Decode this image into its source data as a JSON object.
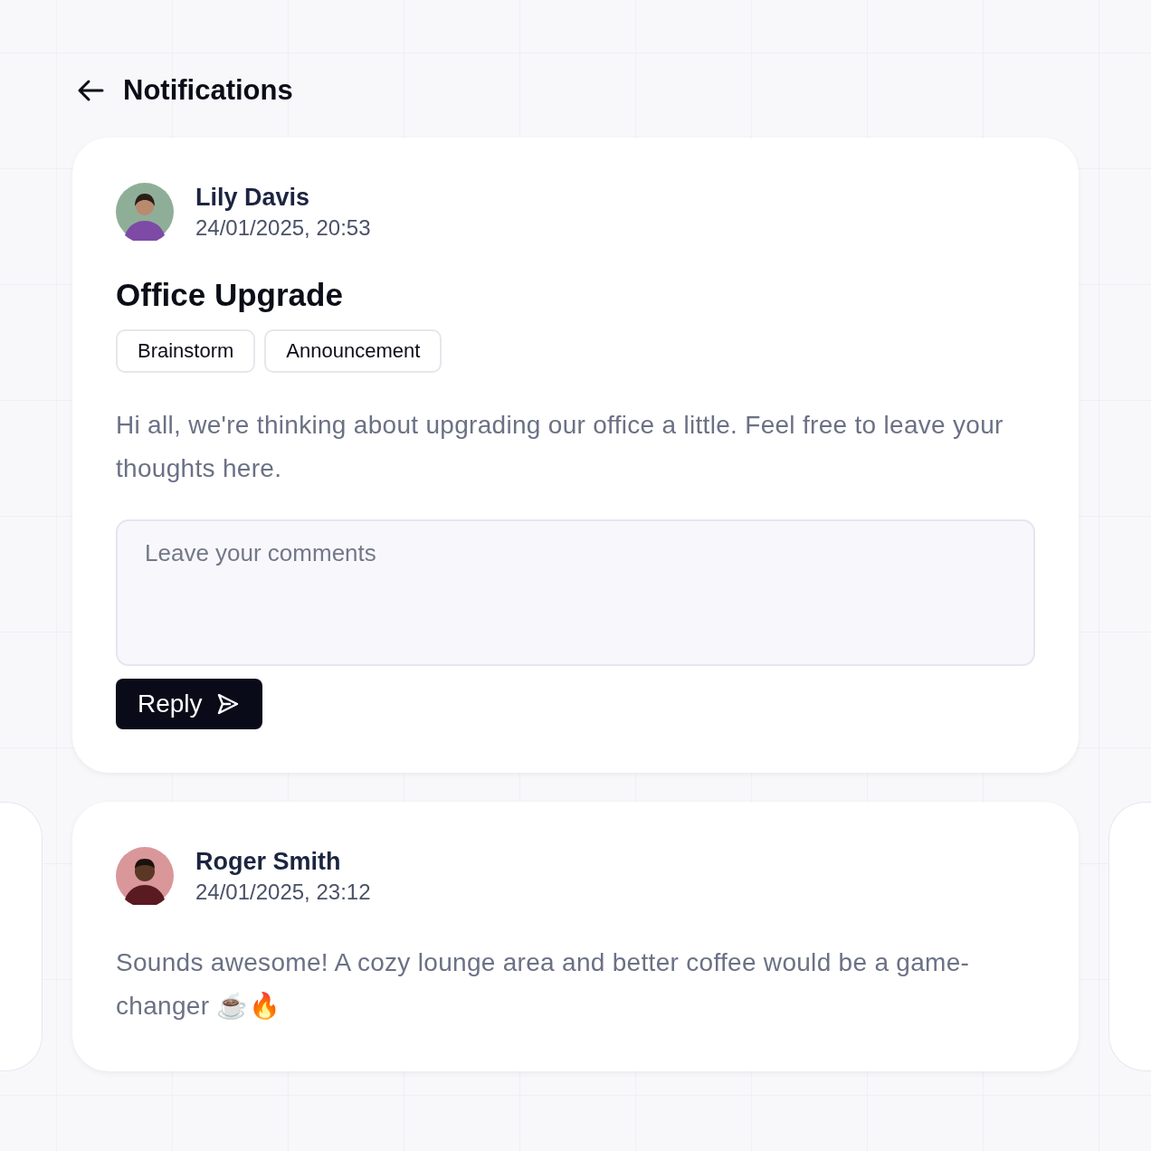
{
  "header": {
    "title": "Notifications"
  },
  "post": {
    "author": "Lily Davis",
    "time": "24/01/2025, 20:53",
    "title": "Office Upgrade",
    "tags": [
      "Brainstorm",
      "Announcement"
    ],
    "body": "Hi all, we're thinking about upgrading our office a little. Feel free to leave your thoughts here.",
    "comment": {
      "placeholder": "Leave your comments"
    },
    "reply_button": "Reply"
  },
  "replies": [
    {
      "author": "Roger Smith",
      "time": "24/01/2025, 23:12",
      "body": "Sounds awesome! A cozy lounge area and better coffee would be a game-changer ☕🔥"
    }
  ]
}
